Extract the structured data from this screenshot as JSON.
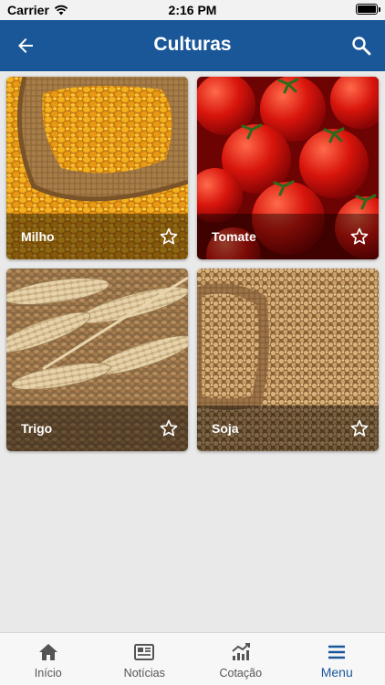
{
  "status_bar": {
    "carrier": "Carrier",
    "time": "2:16 PM"
  },
  "header": {
    "title": "Culturas"
  },
  "crops": [
    {
      "name": "Milho",
      "favorite": false
    },
    {
      "name": "Tomate",
      "favorite": false
    },
    {
      "name": "Trigo",
      "favorite": false
    },
    {
      "name": "Soja",
      "favorite": false
    }
  ],
  "bottom_nav": [
    {
      "label": "Início",
      "icon": "home-icon"
    },
    {
      "label": "Notícias",
      "icon": "newspaper-icon"
    },
    {
      "label": "Cotação",
      "icon": "chart-icon"
    },
    {
      "label": "Menu",
      "icon": "menu-icon",
      "active": true
    }
  ],
  "colors": {
    "primary": "#1a5799",
    "background": "#e9e9e9"
  }
}
